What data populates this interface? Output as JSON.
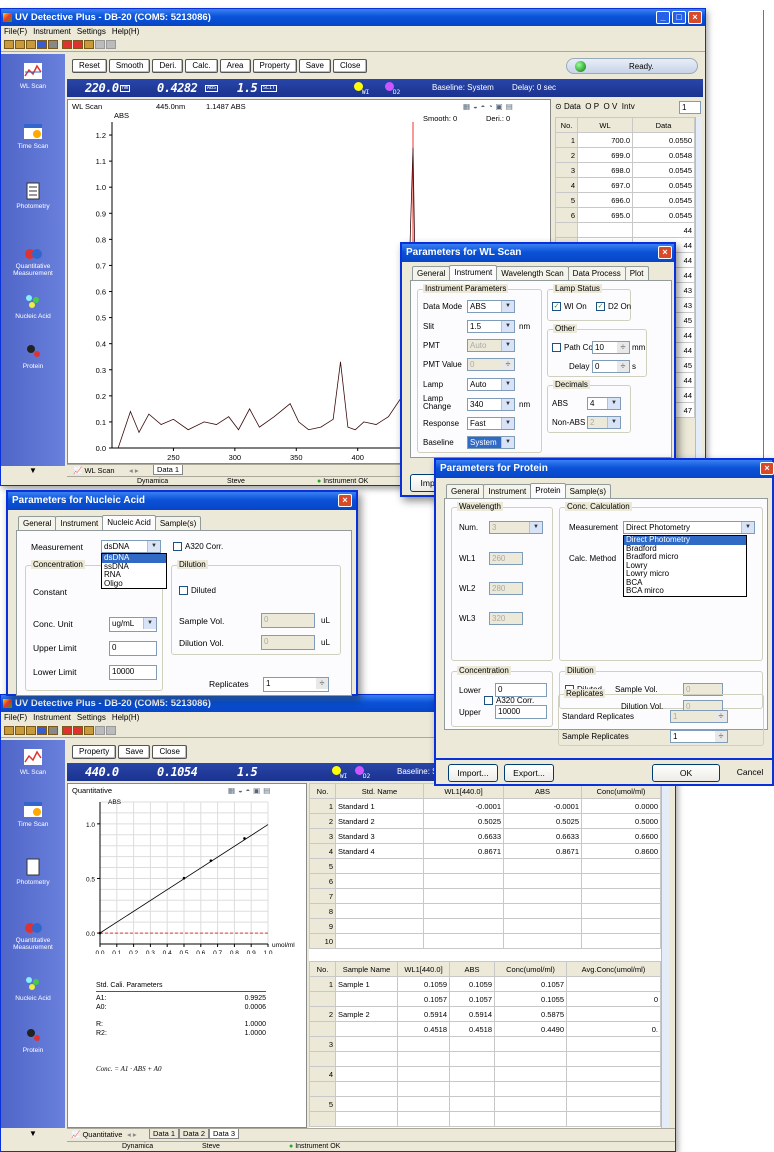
{
  "app1": {
    "title": "UV Detective Plus - DB-20 (COM5: 5213086)",
    "menu": [
      "File(F)",
      "Instrument",
      "Settings",
      "Help(H)"
    ],
    "buttons": [
      "Reset",
      "Smooth",
      "Deri.",
      "Calc.",
      "Area",
      "Property",
      "Save",
      "Close"
    ],
    "status": "Ready.",
    "readout": {
      "wl": "220.0",
      "wl_unit": "nm",
      "abs": "0.4282",
      "abs_unit": "ABS",
      "slit": "1.5",
      "slit_unit": "SLIT",
      "lamp1": "WI",
      "lamp2": "D2",
      "baseline": "Baseline: System",
      "delay": "Delay: 0 sec"
    },
    "plot_info": {
      "mode": "WL Scan",
      "wl": "445.0nm",
      "abs": "1.1487 ABS",
      "ylabel": "ABS",
      "smooth": "Smooth: 0",
      "deri": "Deri.: 0"
    },
    "radio": {
      "data": "Data",
      "p": "P",
      "v": "V",
      "intv": "Intv",
      "intv_value": "1"
    },
    "table": {
      "headers": [
        "No.",
        "WL",
        "Data"
      ],
      "rows": [
        [
          "1",
          "700.0",
          "0.0550"
        ],
        [
          "2",
          "699.0",
          "0.0548"
        ],
        [
          "3",
          "698.0",
          "0.0545"
        ],
        [
          "4",
          "697.0",
          "0.0545"
        ],
        [
          "5",
          "696.0",
          "0.0545"
        ],
        [
          "6",
          "695.0",
          "0.0545"
        ]
      ],
      "partial": [
        "44",
        "44",
        "44",
        "44",
        "43",
        "43",
        "45",
        "44",
        "44",
        "45",
        "44",
        "44",
        "47"
      ]
    },
    "nav": [
      "WL Scan",
      "Time Scan",
      "Photometry",
      "Quantitative Measurement",
      "Nucleic Acid",
      "Protein"
    ],
    "bottom_tab": "WL Scan",
    "sheet_tab": "Data 1"
  },
  "chart_data": [
    {
      "type": "line",
      "title": "",
      "ylabel": "ABS",
      "xlabel": "",
      "xlim": [
        200,
        550
      ],
      "ylim": [
        0,
        1.25
      ],
      "xticks": [
        "250",
        "300",
        "350",
        "400",
        "450",
        "500",
        "550"
      ],
      "yticks": [
        "0.0",
        "0.1",
        "0.2",
        "0.3",
        "0.4",
        "0.5",
        "0.6",
        "0.7",
        "0.8",
        "0.9",
        "1.0",
        "1.1",
        "1.2"
      ],
      "x": [
        205,
        215,
        222,
        230,
        240,
        250,
        262,
        275,
        285,
        295,
        303,
        312,
        320,
        332,
        345,
        352,
        360,
        370,
        380,
        386,
        392,
        398,
        405,
        415,
        425,
        435,
        440,
        443,
        445,
        447,
        450,
        455,
        462,
        470,
        480,
        490,
        500,
        510,
        520,
        530,
        540,
        548
      ],
      "y": [
        0.0,
        0.14,
        0.06,
        0.13,
        0.09,
        0.11,
        0.07,
        0.1,
        0.09,
        0.12,
        0.07,
        0.15,
        0.08,
        0.12,
        0.17,
        0.1,
        0.07,
        0.08,
        0.11,
        0.33,
        0.08,
        0.07,
        0.1,
        0.09,
        0.12,
        0.19,
        0.3,
        0.85,
        1.15,
        0.6,
        0.2,
        0.12,
        0.15,
        0.1,
        0.12,
        0.09,
        0.1,
        0.12,
        0.2,
        0.1,
        0.08,
        0.07
      ],
      "cursor_x": 445
    },
    {
      "type": "line",
      "title": "Quantitative",
      "ylabel": "ABS",
      "xlabel": "umol/ml",
      "xlim": [
        0,
        1.0
      ],
      "ylim": [
        -0.1,
        1.2
      ],
      "xticks": [
        "0.0",
        "0.1",
        "0.2",
        "0.3",
        "0.4",
        "0.5",
        "0.6",
        "0.7",
        "0.8",
        "0.9",
        "1.0"
      ],
      "yticks": [
        "0.0",
        "0.5",
        "1.0"
      ],
      "series": [
        {
          "name": "",
          "x": [
            0.0,
            0.5,
            0.66,
            0.86
          ],
          "y": [
            -0.0001,
            0.5025,
            0.6633,
            0.8671
          ]
        }
      ],
      "fit": {
        "a1": 0.9925,
        "a0": 0.0006
      }
    }
  ],
  "dlg_wl": {
    "title": "Parameters for WL Scan",
    "tabs": [
      "General",
      "Instrument",
      "Wavelength Scan",
      "Data Process",
      "Plot"
    ],
    "ip": "Instrument Parameters",
    "data_mode_l": "Data Mode",
    "data_mode": "ABS",
    "slit_l": "Slit",
    "slit": "1.5",
    "nm": "nm",
    "pmt_l": "PMT",
    "pmt": "Auto",
    "pmtv_l": "PMT Value",
    "pmtv": "0",
    "lamp_l": "Lamp",
    "lamp": "Auto",
    "lampch_l": "Lamp Change",
    "lampch": "340",
    "resp_l": "Response",
    "resp": "Fast",
    "base_l": "Baseline",
    "base": "System",
    "ls": "Lamp Status",
    "wi": "WI On",
    "d2": "D2 On",
    "other": "Other",
    "path": "Path Corr.",
    "path_v": "10",
    "mm": "mm",
    "delay_l": "Delay",
    "delay_v": "0",
    "s": "s",
    "dec": "Decimals",
    "abs_l": "ABS",
    "abs_v": "4",
    "nabs_l": "Non-ABS",
    "nabs_v": "2",
    "btn_partial": "Impo"
  },
  "dlg_prot": {
    "title": "Parameters for Protein",
    "tabs": [
      "General",
      "Instrument",
      "Protein",
      "Sample(s)"
    ],
    "wl": "Wavelength",
    "num_l": "Num.",
    "num": "3",
    "wl1_l": "WL1",
    "wl1": "260",
    "wl2_l": "WL2",
    "wl2": "280",
    "wl3_l": "WL3",
    "wl3": "320",
    "cc": "Conc. Calculation",
    "meas_l": "Measurement",
    "meas": "Direct Photometry",
    "calc_l": "Calc. Method",
    "options": [
      "Direct Photometry",
      "Bradford",
      "Bradford micro",
      "Lowry",
      "Lowry micro",
      "BCA",
      "BCA mirco"
    ],
    "conc": "Concentration",
    "lower_l": "Lower",
    "lower": "0",
    "upper_l": "Upper",
    "upper": "10000",
    "dil": "Dilution",
    "diluted": "Diluted",
    "svol": "Sample Vol.",
    "svol_v": "0",
    "dvol": "Dilution Vol.",
    "dvol_v": "0",
    "a320": "A320 Corr.",
    "rep": "Replicates",
    "srep_l": "Standard Replicates",
    "srep": "1",
    "smp_l": "Sample Replicates",
    "smp": "1",
    "import": "Import...",
    "export": "Export...",
    "ok": "OK",
    "cancel": "Cancel"
  },
  "dlg_na": {
    "title": "Parameters for Nucleic Acid",
    "tabs": [
      "General",
      "Instrument",
      "Nucleic Acid",
      "Sample(s)"
    ],
    "meas_l": "Measurement",
    "meas": "dsDNA",
    "a320": "A320 Corr.",
    "conc": "Concentration",
    "const_l": "Constant",
    "options": [
      "dsDNA",
      "ssDNA",
      "RNA",
      "Oligo"
    ],
    "dil": "Dilution",
    "diluted": "Diluted",
    "svol": "Sample Vol.",
    "svol_v": "0",
    "uL": "uL",
    "dvol": "Dilution Vol.",
    "dvol_v": "0",
    "unit_l": "Conc. Unit",
    "unit": "ug/mL",
    "upper_l": "Upper Limit",
    "upper": "0",
    "lower_l": "Lower Limit",
    "lower": "10000",
    "rep_l": "Replicates",
    "rep": "1"
  },
  "app2": {
    "title": "UV Detective Plus - DB-20 (COM5: 5213086)",
    "menu": [
      "File(F)",
      "Instrument",
      "Settings",
      "Help(H)"
    ],
    "buttons": [
      "Property",
      "Save",
      "Close"
    ],
    "readout": {
      "wl": "440.0",
      "abs": "0.1054",
      "slit": "1.5",
      "lamp1": "WI",
      "lamp2": "D2",
      "baseline": "Baseline: S"
    },
    "std_headers": [
      "No.",
      "Std. Name",
      "WL1[440.0]",
      "ABS",
      "Conc(umol/ml)"
    ],
    "std_rows": [
      [
        "1",
        "Standard 1",
        "-0.0001",
        "-0.0001",
        "0.0000"
      ],
      [
        "2",
        "Standard 2",
        "0.5025",
        "0.5025",
        "0.5000"
      ],
      [
        "3",
        "Standard 3",
        "0.6633",
        "0.6633",
        "0.6600"
      ],
      [
        "4",
        "Standard 4",
        "0.8671",
        "0.8671",
        "0.8600"
      ],
      [
        "5",
        "",
        "",
        "",
        ""
      ],
      [
        "6",
        "",
        "",
        "",
        ""
      ],
      [
        "7",
        "",
        "",
        "",
        ""
      ],
      [
        "8",
        "",
        "",
        "",
        ""
      ],
      [
        "9",
        "",
        "",
        "",
        ""
      ],
      [
        "10",
        "",
        "",
        "",
        ""
      ]
    ],
    "smp_headers": [
      "No.",
      "Sample Name",
      "WL1[440.0]",
      "ABS",
      "Conc(umol/ml)",
      "Avg.Conc(umol/ml)"
    ],
    "smp_rows": [
      [
        "1",
        "Sample 1",
        "0.1059",
        "0.1059",
        "0.1057",
        ""
      ],
      [
        "",
        "",
        "0.1057",
        "0.1057",
        "0.1055",
        "0"
      ],
      [
        "2",
        "Sample 2",
        "0.5914",
        "0.5914",
        "0.5875",
        ""
      ],
      [
        "",
        "",
        "0.4518",
        "0.4518",
        "0.4490",
        "0."
      ],
      [
        "3",
        "",
        "",
        "",
        "",
        ""
      ],
      [
        "",
        "",
        "",
        "",
        "",
        ""
      ],
      [
        "4",
        "",
        "",
        "",
        "",
        ""
      ],
      [
        "",
        "",
        "",
        "",
        "",
        ""
      ],
      [
        "5",
        "",
        "",
        "",
        "",
        ""
      ],
      [
        "",
        "",
        "",
        "",
        "",
        ""
      ]
    ],
    "params": {
      "head": "Std. Cali. Parameters",
      "a1_l": "A1:",
      "a1": "0.9925",
      "a0_l": "A0:",
      "a0": "0.0006",
      "r_l": "R:",
      "r": "1.0000",
      "r2_l": "R2:",
      "r2": "1.0000",
      "formula": "Conc. = A1 · ABS + A0"
    },
    "bottom_tab": "Quantitative",
    "sheet_tabs": [
      "Data 1",
      "Data 2",
      "Data 3"
    ],
    "status": [
      "Dynamica",
      "Steve",
      "Instrument OK"
    ]
  },
  "status1": [
    "Dynamica",
    "Steve",
    "Instrument OK"
  ]
}
